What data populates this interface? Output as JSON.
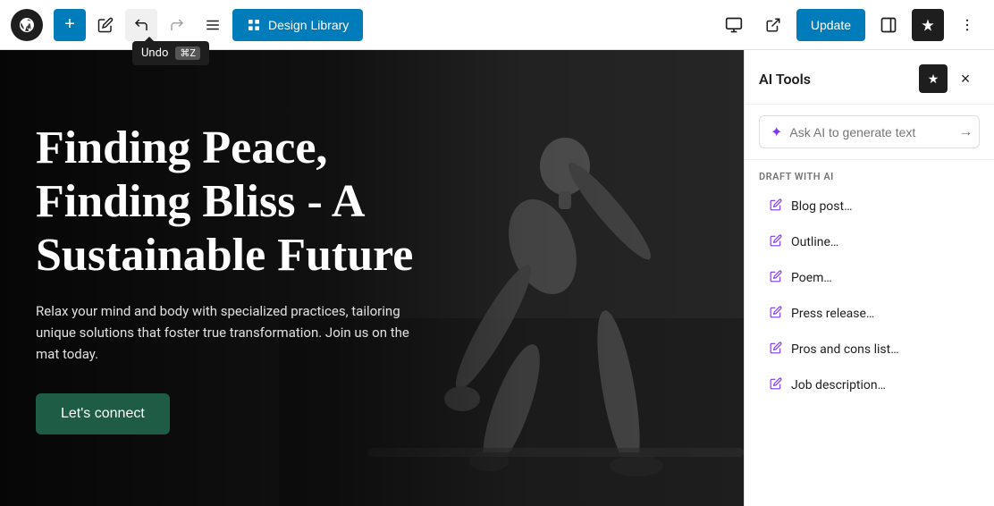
{
  "toolbar": {
    "wp_logo_alt": "WordPress Logo",
    "add_label": "+",
    "edit_label": "✏",
    "undo_label": "↩",
    "redo_label": "↪",
    "list_view_label": "☰",
    "design_library_label": "Design Library",
    "update_label": "Update",
    "preview_label": "preview",
    "external_label": "external",
    "sidebar_label": "sidebar",
    "sparkle_label": "✦",
    "more_label": "⋯",
    "tooltip_undo": "Undo",
    "tooltip_shortcut": "⌘Z"
  },
  "hero": {
    "title": "Finding Peace, Finding Bliss - A Sustainable Future",
    "subtitle": "Relax your mind and body with specialized practices, tailoring unique solutions that foster true transformation. Join us on the mat today.",
    "cta_label": "Let's connect"
  },
  "ai_panel": {
    "title": "AI Tools",
    "star_icon": "★",
    "close_icon": "×",
    "input_placeholder": "Ask AI to generate text",
    "send_icon": "→",
    "draft_section_label": "DRAFT WITH AI",
    "draft_items": [
      {
        "id": "blog-post",
        "label": "Blog post…",
        "icon": "✏"
      },
      {
        "id": "outline",
        "label": "Outline…",
        "icon": "✏"
      },
      {
        "id": "poem",
        "label": "Poem…",
        "icon": "✏"
      },
      {
        "id": "press-release",
        "label": "Press release…",
        "icon": "✏"
      },
      {
        "id": "pros-cons",
        "label": "Pros and cons list…",
        "icon": "✏"
      },
      {
        "id": "job-description",
        "label": "Job description…",
        "icon": "✏"
      }
    ]
  }
}
